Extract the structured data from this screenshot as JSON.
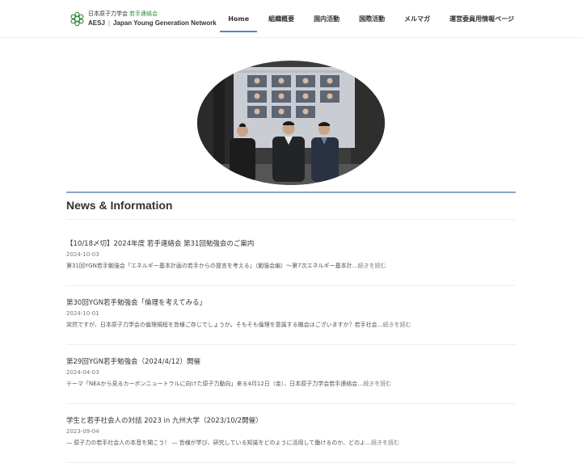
{
  "brand": {
    "line1_main": "日本原子力学会",
    "line1_sub": "若手連絡会",
    "line2_org": "AESJ",
    "line2_sep": "|",
    "line2_name": "Japan Young Generation Network",
    "accent_color": "#2e8b3a"
  },
  "nav": {
    "items": [
      {
        "label": "Home",
        "active": true
      },
      {
        "label": "組織概要"
      },
      {
        "label": "国内活動"
      },
      {
        "label": "国際活動"
      },
      {
        "label": "メルマガ"
      },
      {
        "label": "運営委員用情報ページ"
      }
    ],
    "active_color": "#5a86b0"
  },
  "hero": {
    "image": "group-photo"
  },
  "section": {
    "title": "News & Information"
  },
  "news": [
    {
      "title": "【10/18〆切】2024年度 若手連絡会 第31回勉強会のご案内",
      "date": "2024-10-03",
      "excerpt": "第31回YGN若手勉強会「エネルギー基本計画の若手からの提言を考える」（勉強会編）～第7次エネルギー基本計…",
      "more": "続きを読む"
    },
    {
      "title": "第30回YGN若手勉強会「倫理を考えてみる」",
      "date": "2024-10-01",
      "excerpt": "突然ですが、日本原子力学会の倫理規程を皆様ご存じでしょうか。そもそも倫理を意識する機会はございますか？若手社会…",
      "more": "続きを読む"
    },
    {
      "title": "第29回YGN若手勉強会（2024/4/12）開催",
      "date": "2024-04-03",
      "excerpt": "テーマ「NEAから見るカーボンニュートラルに向けた原子力動向」来る4月12日（金）、日本原子力学会若手連絡会…",
      "more": "続きを読む"
    },
    {
      "title": "学生と若手社会人の対話 2023 in 九州大学（2023/10/2開催）",
      "date": "2023-09-04",
      "excerpt": "― 原子力の若手社会人の本音を聞こう！ ― 皆様が学び、研究している知識をどのように活用して働けるのか、どのよ…",
      "more": "続きを読む"
    }
  ]
}
